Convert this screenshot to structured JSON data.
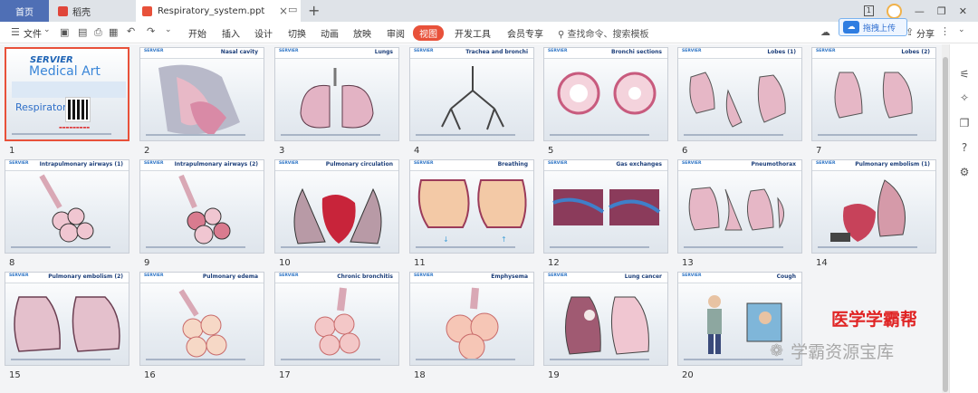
{
  "tabs": {
    "home": "首页",
    "daoke": "稻壳",
    "document": "Respiratory_system.ppt"
  },
  "window": {
    "page_box": "1"
  },
  "toolbar": {
    "file_label": "文件",
    "menus": [
      "开始",
      "插入",
      "设计",
      "切换",
      "动画",
      "放映",
      "审阅",
      "视图",
      "开发工具",
      "会员专享"
    ],
    "active_menu": "视图",
    "search_placeholder": "查找命令、搜索模板",
    "upload_popup": "拖拽上传",
    "share_label": "分享"
  },
  "colors": {
    "accent": "#e8513a",
    "home_tab": "#4f6fb5",
    "title_blue": "#1d3f7a"
  },
  "cover": {
    "brand_line1": "SERVIER",
    "brand_line2": "Medical Art",
    "title": "Respiratory s"
  },
  "slides": [
    {
      "n": "1",
      "title": ""
    },
    {
      "n": "2",
      "title": "Nasal cavity"
    },
    {
      "n": "3",
      "title": "Lungs"
    },
    {
      "n": "4",
      "title": "Trachea and bronchi"
    },
    {
      "n": "5",
      "title": "Bronchi sections"
    },
    {
      "n": "6",
      "title": "Lobes (1)"
    },
    {
      "n": "7",
      "title": "Lobes (2)"
    },
    {
      "n": "8",
      "title": "Intrapulmonary airways (1)"
    },
    {
      "n": "9",
      "title": "Intrapulmonary airways (2)"
    },
    {
      "n": "10",
      "title": "Pulmonary circulation"
    },
    {
      "n": "11",
      "title": "Breathing"
    },
    {
      "n": "12",
      "title": "Gas exchanges"
    },
    {
      "n": "13",
      "title": "Pneumothorax"
    },
    {
      "n": "14",
      "title": "Pulmonary embolism (1)"
    },
    {
      "n": "15",
      "title": "Pulmonary embolism (2)"
    },
    {
      "n": "16",
      "title": "Pulmonary edema"
    },
    {
      "n": "17",
      "title": "Chronic bronchitis"
    },
    {
      "n": "18",
      "title": "Emphysema"
    },
    {
      "n": "19",
      "title": "Lung cancer"
    },
    {
      "n": "20",
      "title": "Cough"
    }
  ],
  "watermarks": {
    "red": "医学学霸帮",
    "gray": "学霸资源宝库"
  }
}
